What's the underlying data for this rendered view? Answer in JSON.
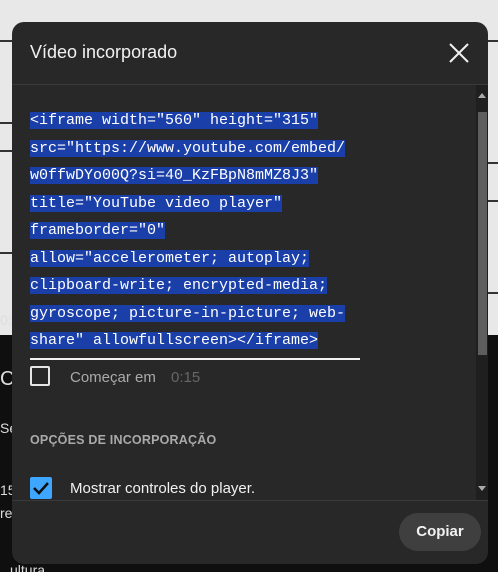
{
  "background": {
    "left_texts": [
      "0:",
      "C",
      "Se",
      "15",
      "re",
      "ultura"
    ]
  },
  "dialog": {
    "title": "Vídeo incorporado",
    "embed_code_lines": [
      "<iframe width=\"560\" height=\"315\"",
      "src=\"https://www.youtube.com/embed/",
      "w0ffwDYo00Q?si=40_KzFBpN8mMZ8J3\"",
      "title=\"YouTube video player\"",
      "frameborder=\"0\"",
      "allow=\"accelerometer; autoplay;",
      "clipboard-write; encrypted-media;",
      "gyroscope; picture-in-picture; web-",
      "share\" allowfullscreen></iframe>"
    ],
    "start_at": {
      "label": "Começar em",
      "time": "0:15",
      "checked": false
    },
    "section_title": "OPÇÕES DE INCORPORAÇÃO",
    "show_controls": {
      "label": "Mostrar controles do player.",
      "checked": true
    },
    "copy_button": "Copiar"
  },
  "colors": {
    "accent": "#3ea6ff",
    "selection": "#1a3fa8",
    "dialog_bg": "#282828"
  }
}
